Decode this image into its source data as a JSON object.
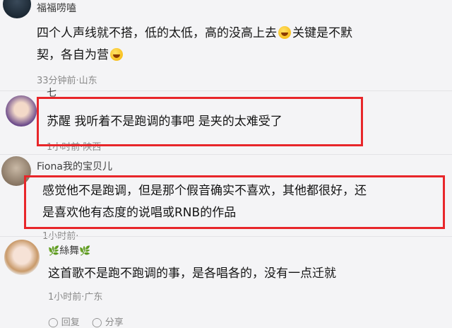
{
  "comments": [
    {
      "username": "福福唠嗑",
      "text_line1": "四个人声线就不搭，低的太低，高的没高上去",
      "text_line1_suffix": "关键是不默",
      "text_line2": "契，各自为营",
      "meta": "33分钟前·山东",
      "emoji": "laughing-tears-emoji"
    },
    {
      "username": "七",
      "text": "苏醒 我听着不是跑调的事吧 是夹的太难受了",
      "meta": "1小时前·陕西"
    },
    {
      "username": "Fiona我的宝贝儿",
      "text_line1": "感觉他不是跑调，但是那个假音确实不喜欢，其他都很好，还",
      "text_line2": "是喜欢他有态度的说唱或RNB的作品",
      "meta": "1小时前·"
    },
    {
      "username": "絲舞",
      "username_decoration": "🌿",
      "text": "这首歌不是跑不跑调的事，是各唱各的，没有一点迁就",
      "meta": "1小时前·广东",
      "actions": [
        "回复",
        "分享"
      ]
    }
  ],
  "colors": {
    "highlight_border": "#e8262a",
    "meta_text": "#8a8a8a",
    "background": "#f4f4f6"
  }
}
